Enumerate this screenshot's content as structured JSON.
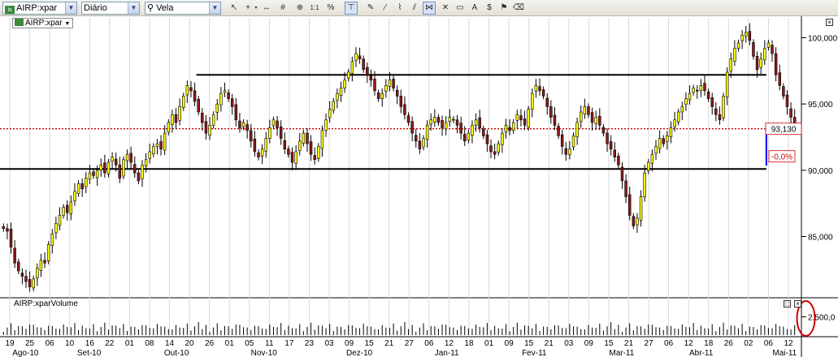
{
  "toolbar": {
    "symbol": "AIRP:xpar",
    "period": "Diário",
    "view": "Vela"
  },
  "main_label": "AIRP:xpar",
  "volume_label": "AIRP:xparVolume",
  "price_tag": "93,130",
  "pct_tag": "-0,0%",
  "colors": {
    "up": "#ffff00",
    "down": "#8b1a1a",
    "price_line": "#cc0000",
    "marker": "#0000ff",
    "circle": "#cc0000"
  },
  "chart_data": {
    "type": "candlestick",
    "y_ticks": [
      "100,000",
      "95,000",
      "90,000",
      "85,000"
    ],
    "y_tick_values": [
      100,
      95,
      90,
      85
    ],
    "ylim": [
      80.5,
      101.5
    ],
    "volume_tick": "2.500,0",
    "volume_tick_value": 2500,
    "day_labels": [
      "19",
      "25",
      "06",
      "10",
      "16",
      "22",
      "01",
      "08",
      "14",
      "20",
      "26",
      "01",
      "05",
      "11",
      "17",
      "23",
      "03",
      "09",
      "15",
      "21",
      "27",
      "06",
      "12",
      "18",
      "01",
      "09",
      "15",
      "21",
      "03",
      "09",
      "15",
      "21",
      "27",
      "06",
      "12",
      "18",
      "26",
      "02",
      "06",
      "12"
    ],
    "month_labels": [
      "Ago-10",
      "Set-10",
      "Out-10",
      "Nov-10",
      "Dez-10",
      "Jan-11",
      "Fev-11",
      "Mar-11",
      "Abr-11",
      "Mai-11"
    ],
    "month_positions": [
      0.03,
      0.11,
      0.22,
      0.33,
      0.45,
      0.56,
      0.67,
      0.78,
      0.88,
      0.985
    ],
    "resistance": 97.2,
    "support": 90.1,
    "last_close": 93.13,
    "closes": [
      85.6,
      85.4,
      84.2,
      83.0,
      82.4,
      82.0,
      81.6,
      81.2,
      81.8,
      82.6,
      83.2,
      83.0,
      84.4,
      85.2,
      86.0,
      86.6,
      87.2,
      86.8,
      87.6,
      88.4,
      89.0,
      88.6,
      89.4,
      89.8,
      89.6,
      90.0,
      90.4,
      89.8,
      90.6,
      91.0,
      90.4,
      89.4,
      90.8,
      91.2,
      90.6,
      89.8,
      89.2,
      90.4,
      90.8,
      91.4,
      91.8,
      92.0,
      91.6,
      92.8,
      93.6,
      94.2,
      93.6,
      94.8,
      95.6,
      96.4,
      96.0,
      95.2,
      94.4,
      93.6,
      92.8,
      93.4,
      94.2,
      95.0,
      95.8,
      96.0,
      95.4,
      94.8,
      93.8,
      93.2,
      93.6,
      93.0,
      92.2,
      91.4,
      91.0,
      91.6,
      92.4,
      93.2,
      93.8,
      93.2,
      92.4,
      91.6,
      91.2,
      90.6,
      91.4,
      92.2,
      92.8,
      92.0,
      91.2,
      90.8,
      91.8,
      93.0,
      93.8,
      94.6,
      95.2,
      95.8,
      96.2,
      96.8,
      97.4,
      98.2,
      98.8,
      98.4,
      97.6,
      97.2,
      96.8,
      96.0,
      95.4,
      95.8,
      96.4,
      96.8,
      96.2,
      95.6,
      94.8,
      94.2,
      93.6,
      92.8,
      92.2,
      91.6,
      92.4,
      93.4,
      93.8,
      94.0,
      93.6,
      93.2,
      93.6,
      94.0,
      93.8,
      93.4,
      92.8,
      92.2,
      92.8,
      93.4,
      93.8,
      93.2,
      92.6,
      92.0,
      91.4,
      91.2,
      92.0,
      92.8,
      93.4,
      93.0,
      93.6,
      94.2,
      93.8,
      93.4,
      94.6,
      95.8,
      96.4,
      96.0,
      95.6,
      94.8,
      94.0,
      93.4,
      92.6,
      91.8,
      91.2,
      91.6,
      92.6,
      93.6,
      94.4,
      94.8,
      94.2,
      93.6,
      94.0,
      93.4,
      92.8,
      92.0,
      91.6,
      91.0,
      90.4,
      89.2,
      88.0,
      86.6,
      85.8,
      86.4,
      88.0,
      89.8,
      90.6,
      91.2,
      91.8,
      92.4,
      92.0,
      92.6,
      93.2,
      93.8,
      94.4,
      94.8,
      95.4,
      95.8,
      96.2,
      96.0,
      96.4,
      96.0,
      95.4,
      94.8,
      94.2,
      93.8,
      95.6,
      97.4,
      98.4,
      99.2,
      99.6,
      100.2,
      100.4,
      99.8,
      98.6,
      97.6,
      98.4,
      99.2,
      99.6,
      98.8,
      97.2,
      96.4,
      95.6,
      94.8,
      94.0,
      93.13
    ],
    "volume_spike_index": 214
  }
}
